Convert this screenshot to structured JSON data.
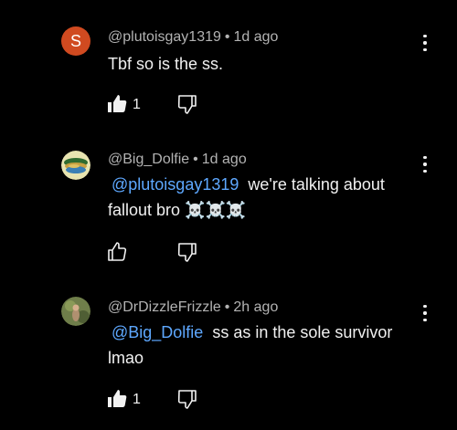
{
  "comments": [
    {
      "author": "@plutoisgay1319",
      "separator": "•",
      "time": "1d ago",
      "avatar_letter": "S",
      "mention": "",
      "text": "Tbf so is the ss.",
      "likes": "1",
      "liked": true
    },
    {
      "author": "@Big_Dolfie",
      "separator": "•",
      "time": "1d ago",
      "avatar_letter": "",
      "mention": "@plutoisgay1319",
      "text": "we're talking about fallout bro ☠️☠️☠️",
      "likes": "",
      "liked": false
    },
    {
      "author": "@DrDizzleFrizzle",
      "separator": "•",
      "time": "2h ago",
      "avatar_letter": "",
      "mention": "@Big_Dolfie",
      "text": "ss as in the sole survivor lmao",
      "likes": "1",
      "liked": true
    }
  ],
  "colors": {
    "background": "#000000",
    "link": "#5ea8ff",
    "meta": "#b3b3b3",
    "avatar_s": "#d04a20"
  }
}
